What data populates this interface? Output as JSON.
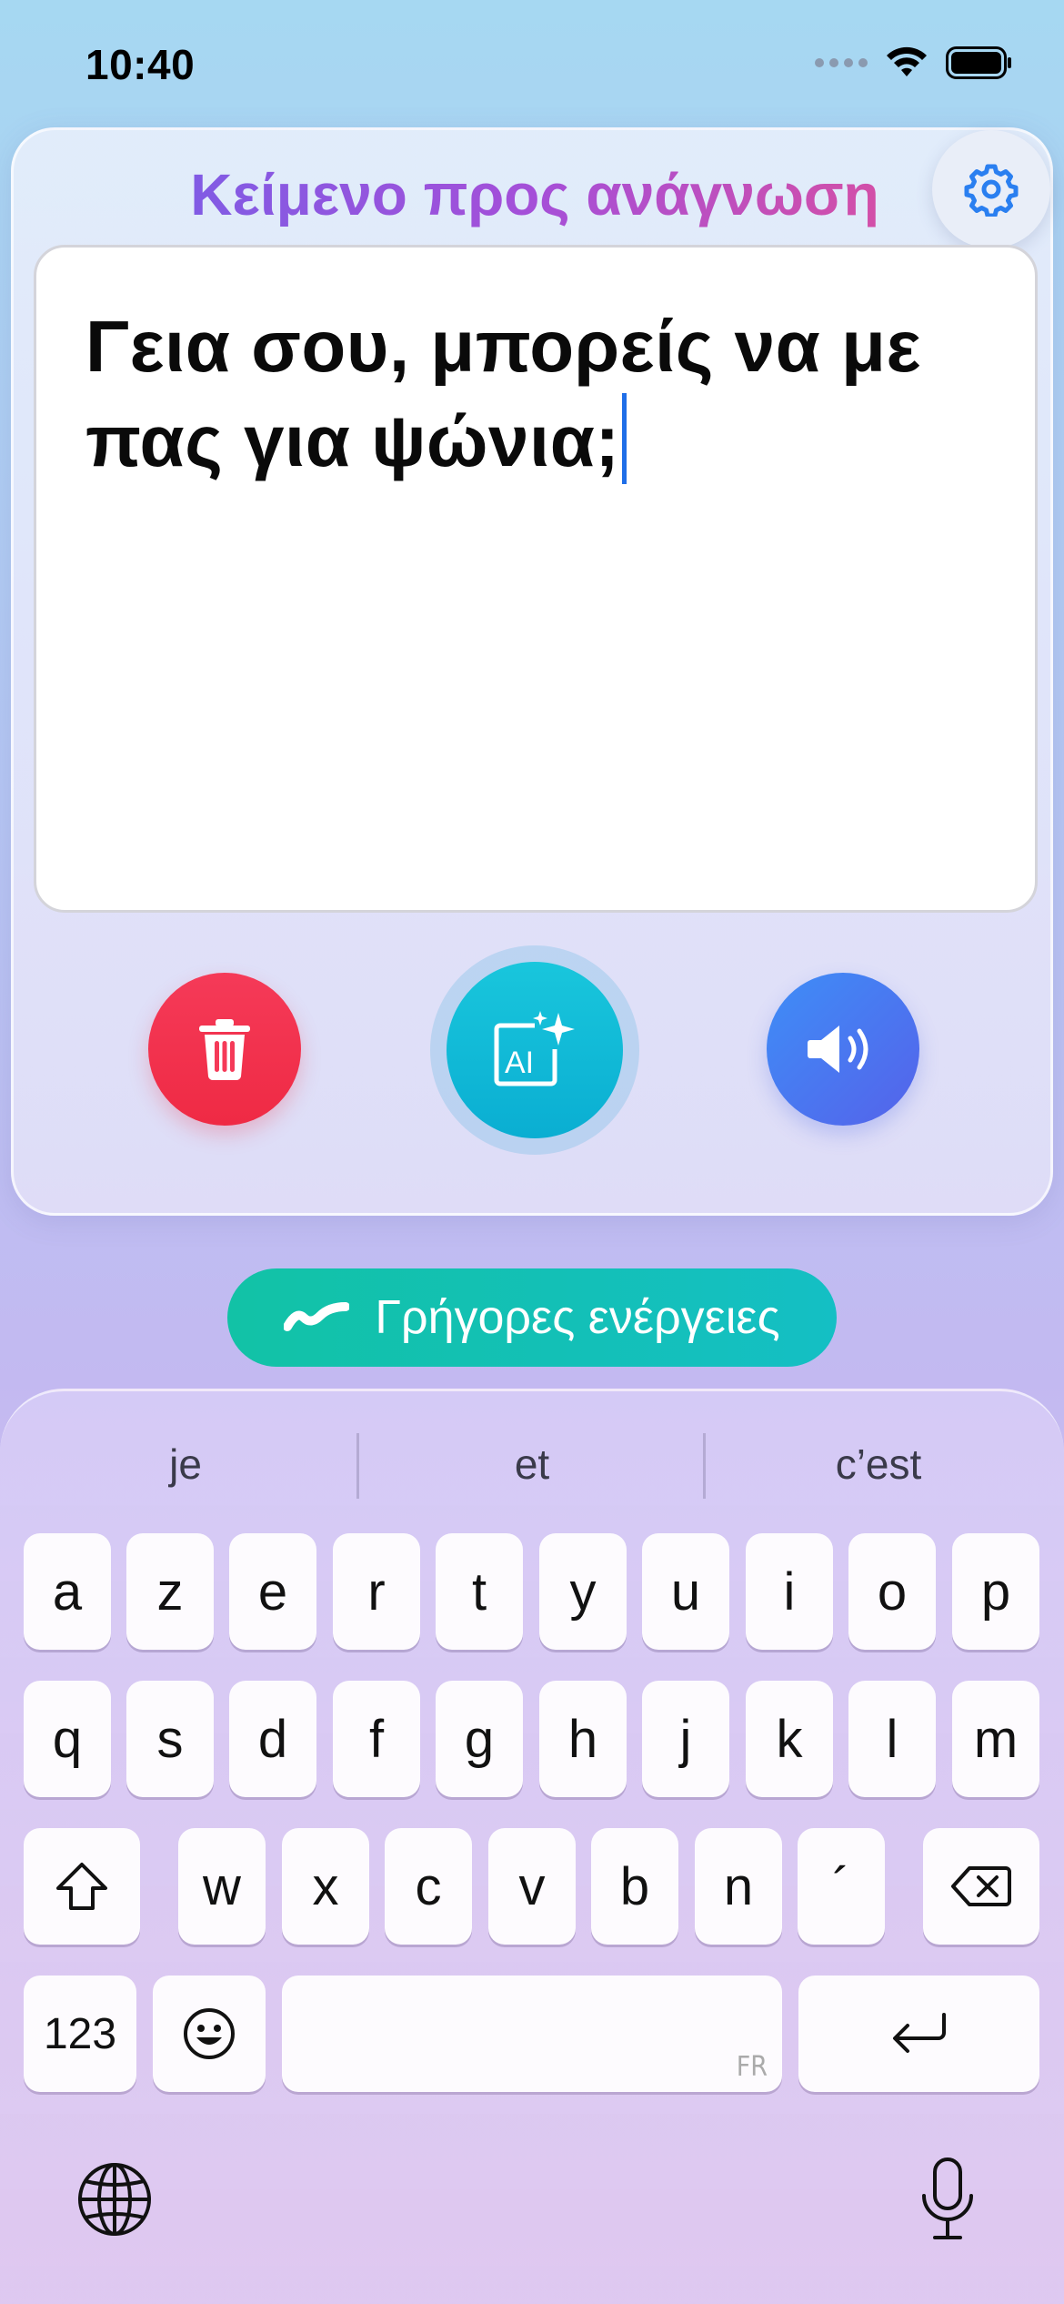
{
  "status_bar": {
    "time": "10:40"
  },
  "card": {
    "title": "Κείμενο προς ανάγνωση",
    "text": "Γεια σου, μπορείς να με πας για ψώνια;"
  },
  "actions": {
    "delete_icon": "trash-icon",
    "ai_icon": "ai-sparkle-icon",
    "speak_icon": "speaker-icon"
  },
  "quick_actions": {
    "label": "Γρήγορες ενέργειες",
    "icon": "zigzag-icon"
  },
  "keyboard": {
    "suggestions": [
      "je",
      "et",
      "c’est"
    ],
    "row1": [
      "a",
      "z",
      "e",
      "r",
      "t",
      "y",
      "u",
      "i",
      "o",
      "p"
    ],
    "row2": [
      "q",
      "s",
      "d",
      "f",
      "g",
      "h",
      "j",
      "k",
      "l",
      "m"
    ],
    "row3": [
      "w",
      "x",
      "c",
      "v",
      "b",
      "n",
      "´"
    ],
    "numbers_label": "123",
    "space_language": "FR"
  },
  "colors": {
    "title_gradient": [
      "#6e61ea",
      "#ea4f8f"
    ],
    "delete": "#f53a58",
    "ai": "#19c6dc",
    "speak": "#4a7af0",
    "quick_actions": "#12c2a6"
  }
}
